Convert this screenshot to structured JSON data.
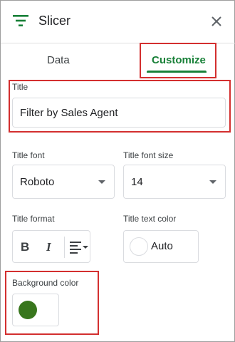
{
  "header": {
    "title": "Slicer",
    "filter_icon": "filter-icon",
    "close_icon": "close-icon"
  },
  "tabs": [
    {
      "label": "Data",
      "active": false
    },
    {
      "label": "Customize",
      "active": true
    }
  ],
  "form": {
    "title_label": "Title",
    "title_value": "Filter by Sales Agent",
    "title_font_label": "Title font",
    "title_font_value": "Roboto",
    "title_font_size_label": "Title font size",
    "title_font_size_value": "14",
    "title_format_label": "Title format",
    "title_text_color_label": "Title text color",
    "title_text_color_value": "Auto",
    "background_color_label": "Background color",
    "background_color": "#38761d"
  },
  "colors": {
    "accent": "#188038",
    "highlight": "#d32f2f",
    "text_color_swatch": "#ffffff"
  }
}
